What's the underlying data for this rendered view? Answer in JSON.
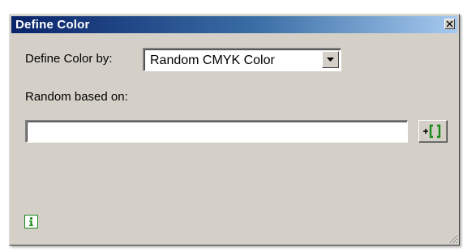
{
  "window": {
    "title": "Define Color"
  },
  "form": {
    "define_color_label": "Define Color by:",
    "define_color_selected": "Random CMYK Color",
    "random_based_on_label": "Random based on:",
    "random_based_on_value": ""
  },
  "icons": {
    "close": "close-icon",
    "dropdown": "chevron-down-icon",
    "add_token": "add-token-icon",
    "info": "info-icon",
    "resize": "resize-grip-icon"
  },
  "colors": {
    "titlebar_start": "#0a246a",
    "titlebar_end": "#a6caf0",
    "dialog_bg": "#d4d0c8",
    "accent_green": "#1a8a1a"
  }
}
